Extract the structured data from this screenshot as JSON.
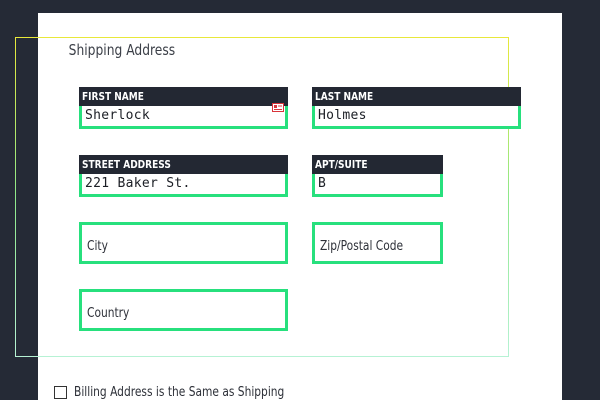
{
  "form": {
    "legend": "Shipping Address",
    "fields": {
      "first_name": {
        "label": "FIRST NAME",
        "value": "Sherlock"
      },
      "last_name": {
        "label": "LAST NAME",
        "value": "Holmes"
      },
      "street": {
        "label": "STREET ADDRESS",
        "value": "221 Baker St."
      },
      "apt": {
        "label": "APT/SUITE",
        "value": "B"
      },
      "city": {
        "placeholder": "City"
      },
      "zip": {
        "placeholder": "Zip/Postal Code"
      },
      "country": {
        "placeholder": "Country"
      }
    },
    "billing_checkbox": {
      "label": "Billing Address is the Same as Shipping",
      "checked": false
    }
  },
  "icons": {
    "autofill": "contact-card-icon"
  },
  "colors": {
    "page_bg": "#252a36",
    "field_border": "#27e07d",
    "label_bg": "#232833",
    "autofill_icon": "#d9343a"
  }
}
